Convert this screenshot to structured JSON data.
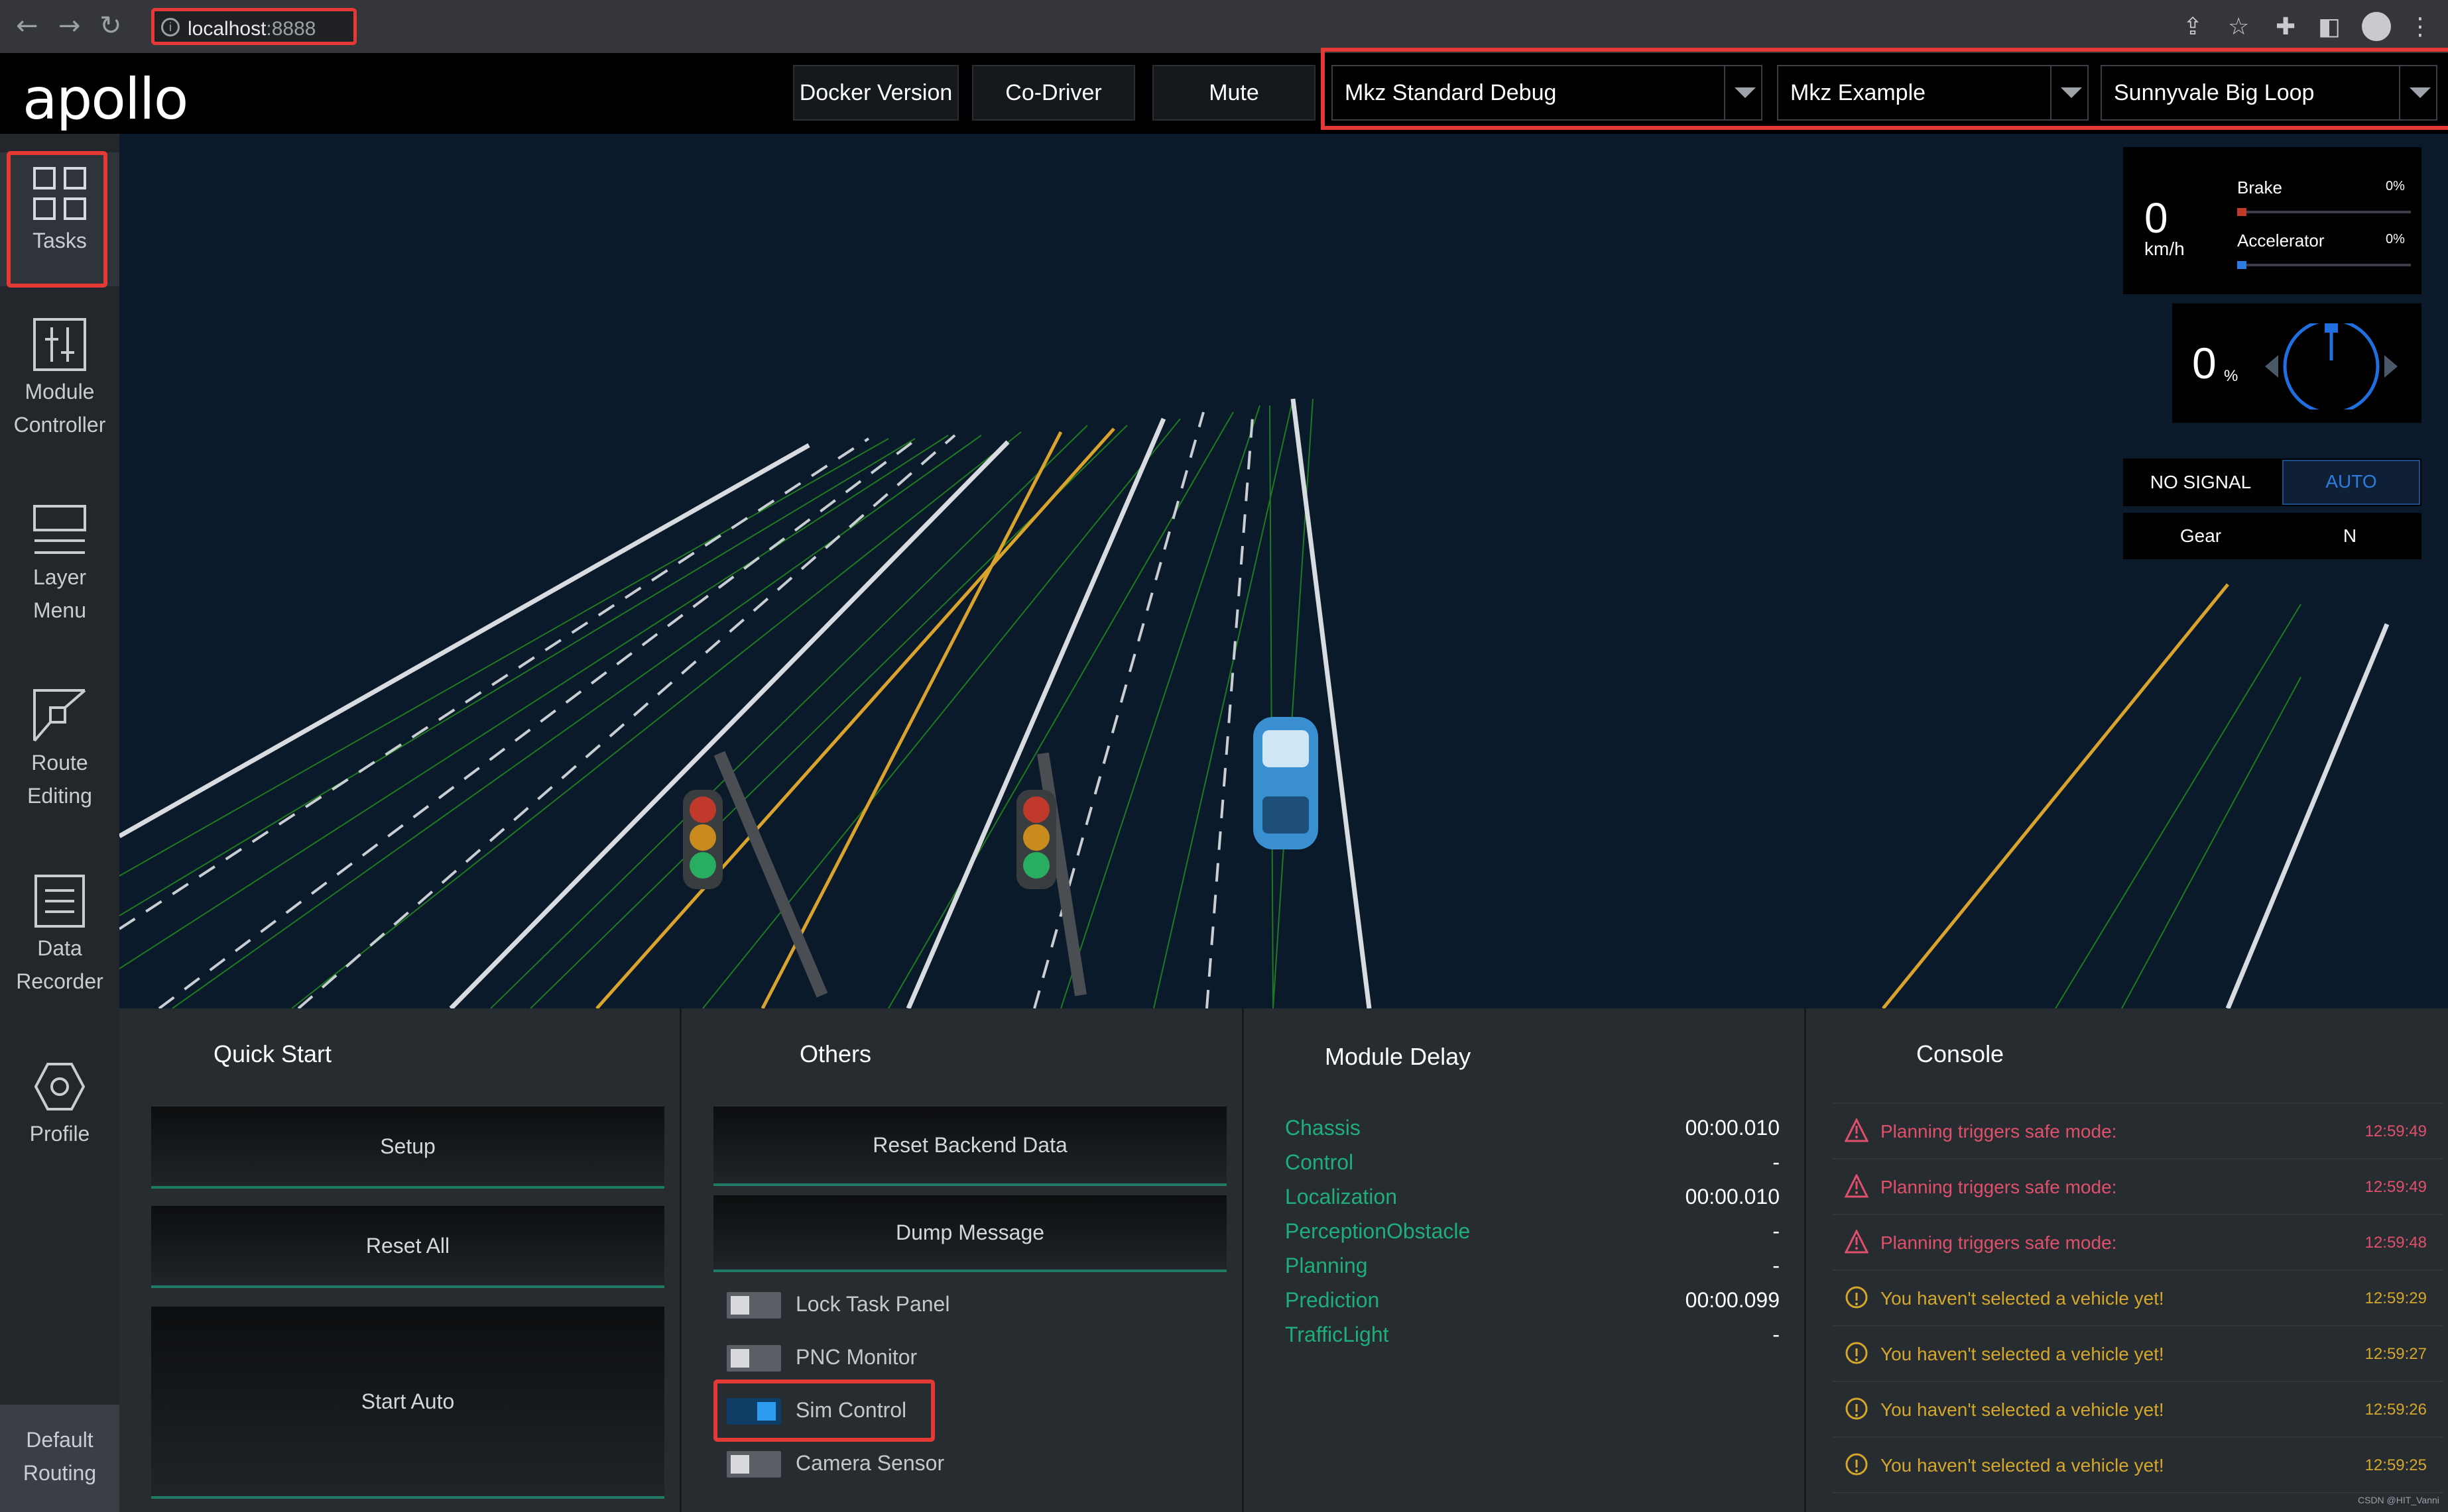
{
  "browser": {
    "url_host": "localhost",
    "url_port": ":8888",
    "back_icon": "←",
    "forward_icon": "→",
    "reload_icon": "↻",
    "info_icon": "i"
  },
  "header": {
    "logo": "apollo",
    "buttons": [
      "Docker Version",
      "Co-Driver",
      "Mute"
    ],
    "selects": [
      "Mkz Standard Debug",
      "Mkz Example",
      "Sunnyvale Big Loop"
    ]
  },
  "sidebar": {
    "items": [
      {
        "label1": "Tasks",
        "label2": ""
      },
      {
        "label1": "Module",
        "label2": "Controller"
      },
      {
        "label1": "Layer",
        "label2": "Menu"
      },
      {
        "label1": "Route",
        "label2": "Editing"
      },
      {
        "label1": "Data",
        "label2": "Recorder"
      },
      {
        "label1": "Profile",
        "label2": ""
      }
    ],
    "default_routing": {
      "label1": "Default",
      "label2": "Routing"
    }
  },
  "status": {
    "speed": "0",
    "speed_unit": "km/h",
    "brake_label": "Brake",
    "brake_value": "0%",
    "brake_level": 0,
    "accel_label": "Accelerator",
    "accel_value": "0%",
    "accel_level": 0,
    "steering": "0",
    "steering_unit": "%",
    "signal": "NO SIGNAL",
    "mode": "AUTO",
    "gear_label": "Gear",
    "gear_value": "N"
  },
  "quick_start": {
    "title": "Quick Start",
    "buttons": [
      "Setup",
      "Reset All",
      "Start Auto"
    ]
  },
  "others": {
    "title": "Others",
    "buttons": [
      "Reset Backend Data",
      "Dump Message"
    ],
    "toggles": [
      {
        "label": "Lock Task Panel",
        "on": false
      },
      {
        "label": "PNC Monitor",
        "on": false
      },
      {
        "label": "Sim Control",
        "on": true
      },
      {
        "label": "Camera Sensor",
        "on": false
      }
    ]
  },
  "module_delay": {
    "title": "Module Delay",
    "rows": [
      {
        "name": "Chassis",
        "value": "00:00.010"
      },
      {
        "name": "Control",
        "value": "-"
      },
      {
        "name": "Localization",
        "value": "00:00.010"
      },
      {
        "name": "PerceptionObstacle",
        "value": "-"
      },
      {
        "name": "Planning",
        "value": "-"
      },
      {
        "name": "Prediction",
        "value": "00:00.099"
      },
      {
        "name": "TrafficLight",
        "value": "-"
      }
    ]
  },
  "console": {
    "title": "Console",
    "colors": {
      "error": "#e0506a",
      "warn": "#d4a72c"
    },
    "rows": [
      {
        "level": "error",
        "msg": "Planning triggers safe mode:",
        "time": "12:59:49"
      },
      {
        "level": "error",
        "msg": "Planning triggers safe mode:",
        "time": "12:59:49"
      },
      {
        "level": "error",
        "msg": "Planning triggers safe mode:",
        "time": "12:59:48"
      },
      {
        "level": "warn",
        "msg": "You haven't selected a vehicle yet!",
        "time": "12:59:29"
      },
      {
        "level": "warn",
        "msg": "You haven't selected a vehicle yet!",
        "time": "12:59:27"
      },
      {
        "level": "warn",
        "msg": "You haven't selected a vehicle yet!",
        "time": "12:59:26"
      },
      {
        "level": "warn",
        "msg": "You haven't selected a vehicle yet!",
        "time": "12:59:25"
      }
    ]
  },
  "watermark": "CSDN @HIT_Vanni"
}
